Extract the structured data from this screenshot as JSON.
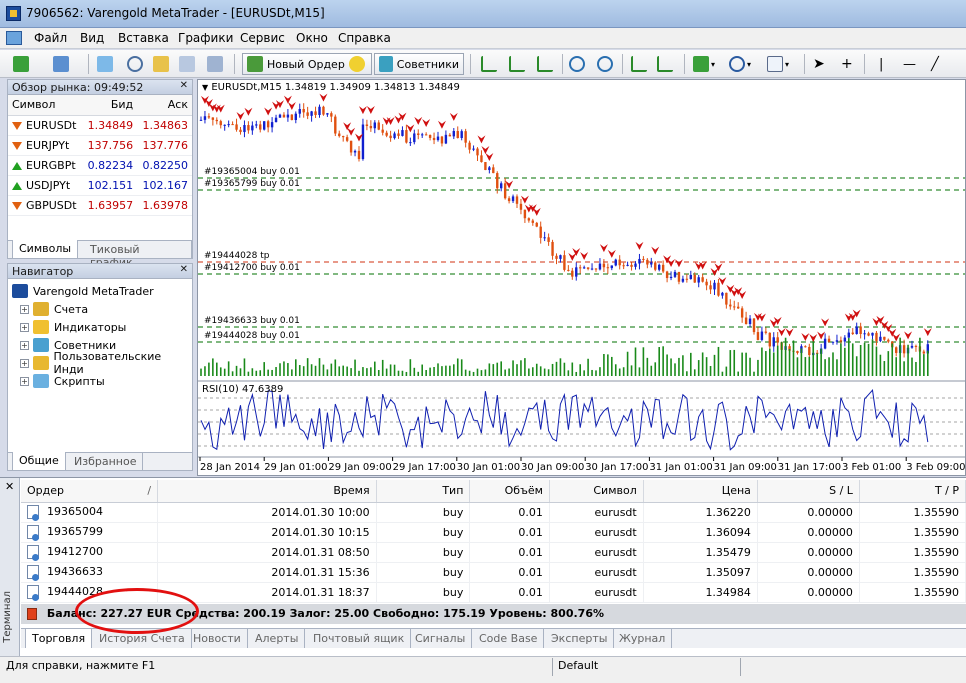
{
  "window": {
    "title": "7906562: Varengold MetaTrader - [EURUSDt,M15]"
  },
  "menu": [
    "Файл",
    "Вид",
    "Вставка",
    "Графики",
    "Сервис",
    "Окно",
    "Справка"
  ],
  "toolbar": {
    "new_order_label": "Новый Ордер",
    "advisors_label": "Советники"
  },
  "market_watch": {
    "header": "Обзор рынка: 09:49:52",
    "columns": [
      "Символ",
      "Бид",
      "Аск"
    ],
    "rows": [
      {
        "symbol": "EURUSDt",
        "bid": "1.34849",
        "ask": "1.34863",
        "dir": "down"
      },
      {
        "symbol": "EURJPYt",
        "bid": "137.756",
        "ask": "137.776",
        "dir": "down"
      },
      {
        "symbol": "EURGBPt",
        "bid": "0.82234",
        "ask": "0.82250",
        "dir": "up"
      },
      {
        "symbol": "USDJPYt",
        "bid": "102.151",
        "ask": "102.167",
        "dir": "up"
      },
      {
        "symbol": "GBPUSDt",
        "bid": "1.63957",
        "ask": "1.63978",
        "dir": "down"
      }
    ],
    "tabs": [
      "Символы",
      "Тиковый график"
    ]
  },
  "navigator": {
    "header": "Навигатор",
    "root": "Varengold MetaTrader",
    "items": [
      "Счета",
      "Индикаторы",
      "Советники",
      "Пользовательские Инди",
      "Скрипты"
    ],
    "tabs": [
      "Общие",
      "Избранное"
    ]
  },
  "chart": {
    "header": "EURUSDt,M15  1.34819 1.34909 1.34813 1.34849",
    "order_lines": [
      {
        "label": "#19365004 buy 0.01"
      },
      {
        "label": "#19365799 buy 0.01"
      },
      {
        "label": "#19444028 tp"
      },
      {
        "label": "#19412700 buy 0.01"
      },
      {
        "label": "#19436633 buy 0.01"
      },
      {
        "label": "#19444028 buy 0.01"
      }
    ],
    "rsi_label": "RSI(10) 47.6389",
    "time_labels": [
      "28 Jan 2014",
      "29 Jan 01:00",
      "29 Jan 09:00",
      "29 Jan 17:00",
      "30 Jan 01:00",
      "30 Jan 09:00",
      "30 Jan 17:00",
      "31 Jan 01:00",
      "31 Jan 09:00",
      "31 Jan 17:00",
      "3 Feb 01:00",
      "3 Feb 09:00"
    ]
  },
  "terminal": {
    "side_label": "Терминал",
    "columns": [
      "Ордер",
      "/",
      "Время",
      "Тип",
      "Объём",
      "Символ",
      "Цена",
      "S / L",
      "T / P"
    ],
    "rows": [
      {
        "order": "19365004",
        "time": "2014.01.30 10:00",
        "type": "buy",
        "volume": "0.01",
        "symbol": "eurusdt",
        "price": "1.36220",
        "sl": "0.00000",
        "tp": "1.35590"
      },
      {
        "order": "19365799",
        "time": "2014.01.30 10:15",
        "type": "buy",
        "volume": "0.01",
        "symbol": "eurusdt",
        "price": "1.36094",
        "sl": "0.00000",
        "tp": "1.35590"
      },
      {
        "order": "19412700",
        "time": "2014.01.31 08:50",
        "type": "buy",
        "volume": "0.01",
        "symbol": "eurusdt",
        "price": "1.35479",
        "sl": "0.00000",
        "tp": "1.35590"
      },
      {
        "order": "19436633",
        "time": "2014.01.31 15:36",
        "type": "buy",
        "volume": "0.01",
        "symbol": "eurusdt",
        "price": "1.35097",
        "sl": "0.00000",
        "tp": "1.35590"
      },
      {
        "order": "19444028",
        "time": "2014.01.31 18:37",
        "type": "buy",
        "volume": "0.01",
        "symbol": "eurusdt",
        "price": "1.34984",
        "sl": "0.00000",
        "tp": "1.35590"
      }
    ],
    "balance_text": "Баланс: 227.27 EUR  Средства: 200.19  Залог: 25.00  Свободно: 175.19  Уровень: 800.76%",
    "tabs": [
      "Торговля",
      "История Счета",
      "Новости",
      "Алерты",
      "Почтовый ящик",
      "Сигналы",
      "Code Base",
      "Эксперты",
      "Журнал"
    ]
  },
  "status": {
    "help": "Для справки, нажмите F1",
    "profile": "Default"
  },
  "colors": {
    "bull_candle": "#1020d0",
    "bear_candle": "#e05010",
    "volume": "#1a8a1a",
    "arrow_sell": "#d01010",
    "buy_line": "#007000",
    "tp_line": "#d03010"
  }
}
